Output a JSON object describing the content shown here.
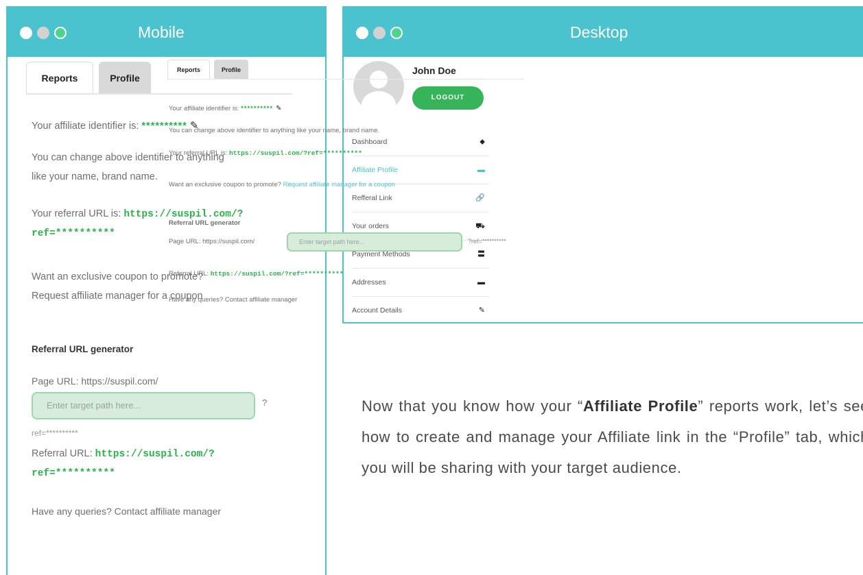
{
  "mobile": {
    "title": "Mobile",
    "tabs": [
      "Reports",
      "Profile"
    ],
    "identifier_label": "Your affiliate identifier is:",
    "identifier_value": "**********",
    "change_note_line1": "You can change above identifier to anything",
    "change_note_line2": "like your name, brand name.",
    "referral_label": "Your referral URL is:",
    "referral_url_line1": "https://suspil.com/?",
    "referral_url_line2": "ref=**********",
    "coupon_line1": "Want an exclusive coupon to promote?",
    "coupon_line2": "Request affiliate manager for a coupon",
    "generator_heading": "Referral URL generator",
    "page_url_label": "Page URL: https://suspil.com/",
    "input_placeholder": "Enter target path here...",
    "query_mark": "?",
    "ref_suffix": "ref=**********",
    "generated_label": "Referral URL:",
    "generated_line1": "https://suspil.com/?",
    "generated_line2": "ref=**********",
    "queries_text": "Have any queries? Contact affiliate manager"
  },
  "desktop": {
    "title": "Desktop",
    "user_name": "John Doe",
    "logout_label": "LOGOUT",
    "nav": [
      {
        "label": "Dashboard",
        "icon": "⬥"
      },
      {
        "label": "Affiliate Profile",
        "icon": "▬"
      },
      {
        "label": "Refferal Link",
        "icon": "🔗"
      },
      {
        "label": "Your orders",
        "icon": "⛟"
      },
      {
        "label": "Payment Methods",
        "icon": "〓"
      },
      {
        "label": "Addresses",
        "icon": "▬"
      },
      {
        "label": "Account Details",
        "icon": "✎"
      }
    ],
    "tabs": [
      "Reports",
      "Profile"
    ],
    "identifier_label": "Your affiliate identifier is:",
    "identifier_value": "**********",
    "change_note": "You can change above identifier to anything like your name, brand name.",
    "referral_label": "Your referral URL is:",
    "referral_url": "https://suspil.com/?ref=**********",
    "coupon_text": "Want an exclusive coupon to promote?",
    "coupon_link": "Request affiliate manager for a coupon",
    "generator_heading": "Referral URL generator",
    "page_url_label": "Page URL: https://suspil.com/",
    "input_placeholder": "Enter target path here...",
    "ref_suffix": "?ref=**********",
    "generated_label": "Referral URL:",
    "generated_url": "https://suspil.com/?ref=**********",
    "queries_text": "Have any queries? Contact affiliate manager"
  },
  "paragraph": {
    "part1": "Now that you know how your “",
    "bold": "Affiliate Profile",
    "part2": "” reports work, let’s see how to create and manage your Affiliate link in the “Profile” tab, which you will be sharing with your target audience."
  },
  "colors": {
    "accent": "#4bc3cf",
    "green": "#36b45a",
    "input_bg": "#d8ecdc"
  }
}
